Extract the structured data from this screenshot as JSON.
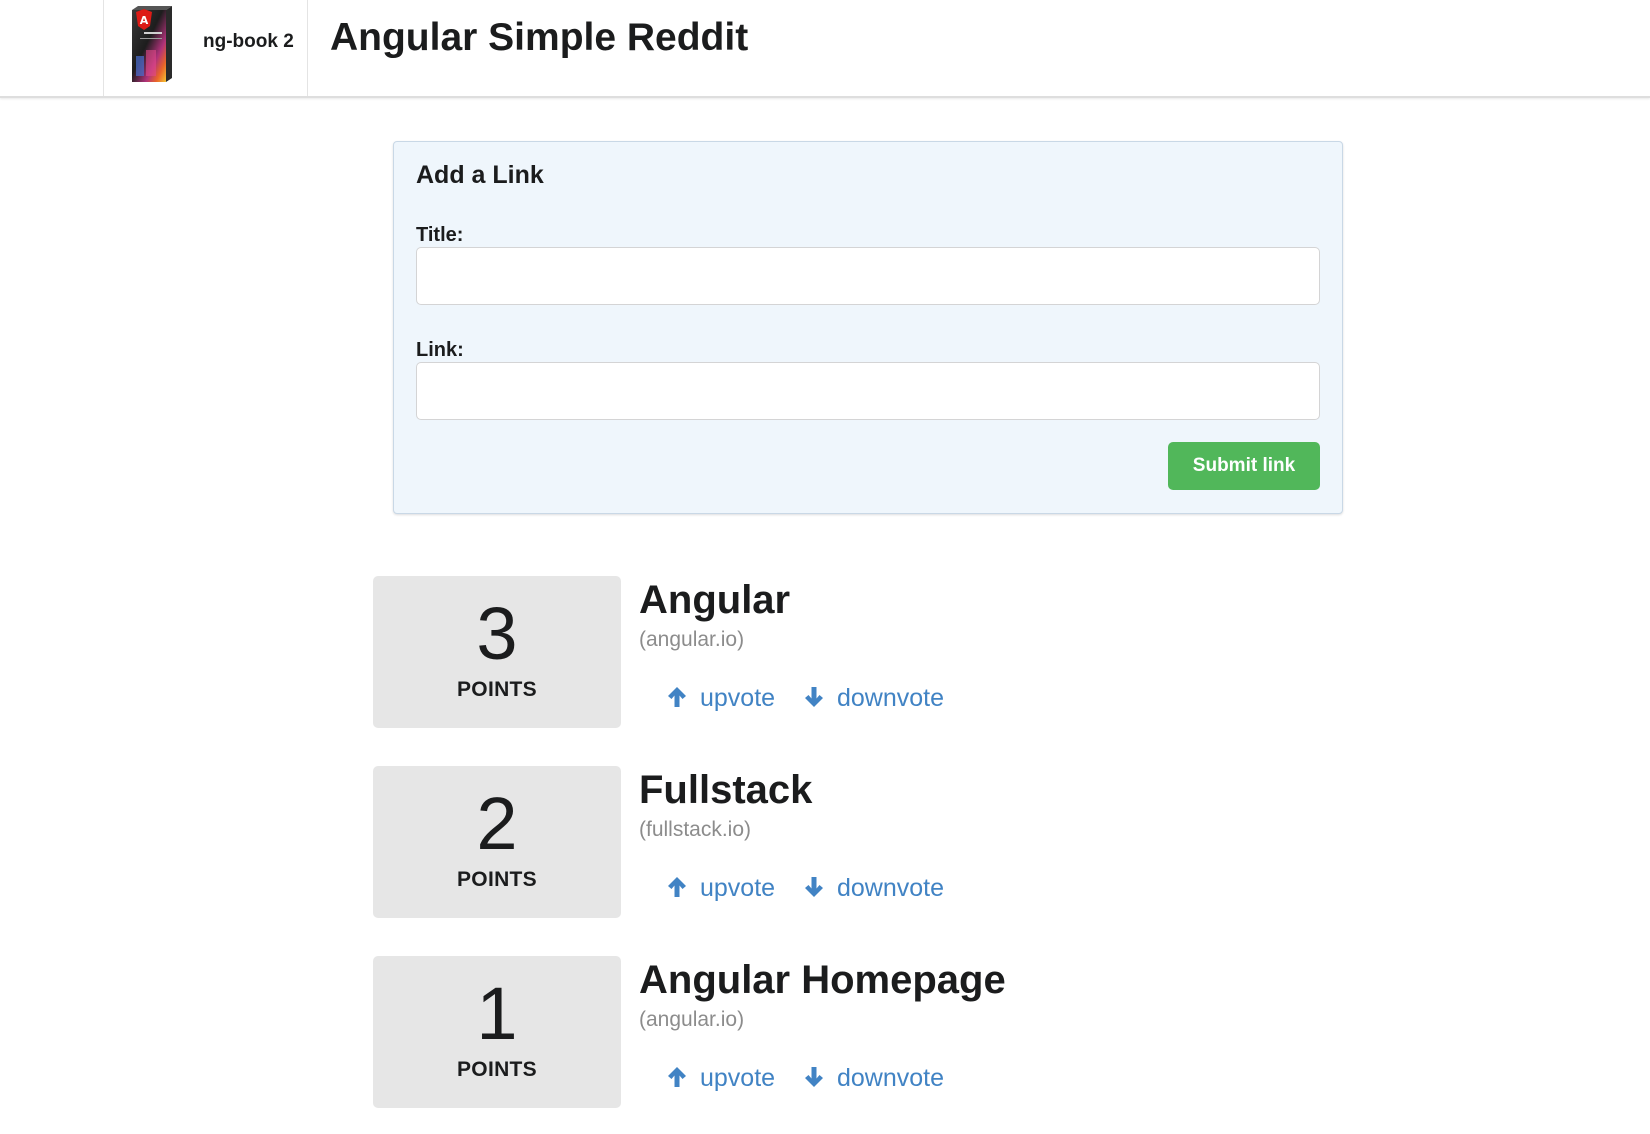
{
  "header": {
    "brand_name": "ng-book 2",
    "title": "Angular Simple Reddit"
  },
  "form": {
    "heading": "Add a Link",
    "title_label": "Title:",
    "title_value": "",
    "link_label": "Link:",
    "link_value": "",
    "submit_label": "Submit link"
  },
  "articles": [
    {
      "votes": "3",
      "points_label": "POINTS",
      "title": "Angular",
      "domain": "(angular.io)",
      "upvote_label": "upvote",
      "downvote_label": "downvote"
    },
    {
      "votes": "2",
      "points_label": "POINTS",
      "title": "Fullstack",
      "domain": "(fullstack.io)",
      "upvote_label": "upvote",
      "downvote_label": "downvote"
    },
    {
      "votes": "1",
      "points_label": "POINTS",
      "title": "Angular Homepage",
      "domain": "(angular.io)",
      "upvote_label": "upvote",
      "downvote_label": "downvote"
    }
  ],
  "colors": {
    "link": "#4183c4",
    "submit_button": "#51b75a",
    "form_background": "#eff6fc",
    "votes_background": "#e6e6e6"
  },
  "icons": {
    "upvote": "arrow-up-icon",
    "downvote": "arrow-down-icon",
    "logo": "ng-book-cover-logo"
  }
}
